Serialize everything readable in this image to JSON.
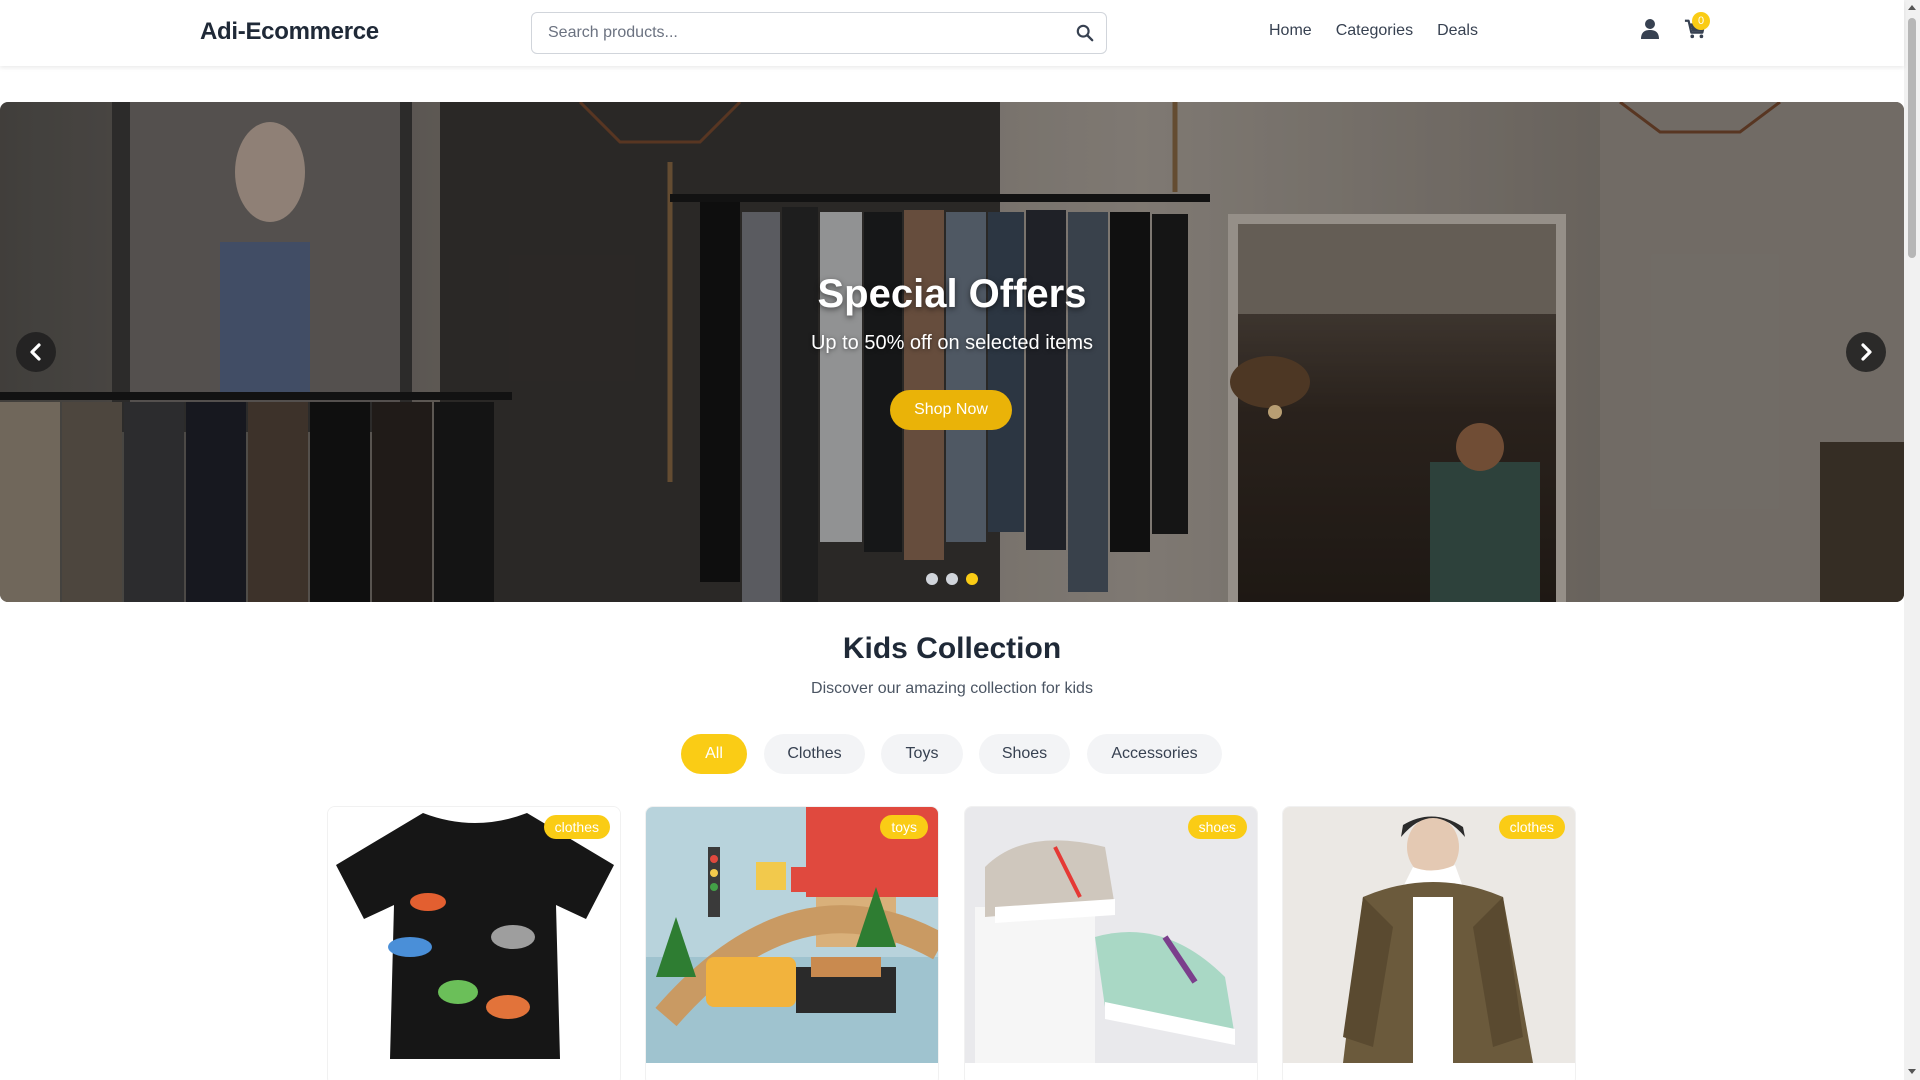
{
  "header": {
    "logo": "Adi-Ecommerce",
    "search_placeholder": "Search products...",
    "nav": [
      "Home",
      "Categories",
      "Deals"
    ],
    "cart_count": "0"
  },
  "hero": {
    "title": "Special Offers",
    "subtitle": "Up to 50% off on selected items",
    "button": "Shop Now",
    "slides": 3,
    "active_slide": 3
  },
  "collection": {
    "title": "Kids Collection",
    "subtitle": "Discover our amazing collection for kids",
    "filters": [
      "All",
      "Clothes",
      "Toys",
      "Shoes",
      "Accessories"
    ],
    "active_filter": "All",
    "products": [
      {
        "category": "clothes"
      },
      {
        "category": "toys"
      },
      {
        "category": "shoes"
      },
      {
        "category": "clothes"
      }
    ]
  },
  "colors": {
    "accent": "#facc15",
    "accent_dark": "#eab308",
    "text": "#1f2937"
  },
  "icons": {
    "search": "search-icon",
    "user": "user-icon",
    "cart": "cart-icon",
    "prev": "chevron-left-icon",
    "next": "chevron-right-icon"
  }
}
